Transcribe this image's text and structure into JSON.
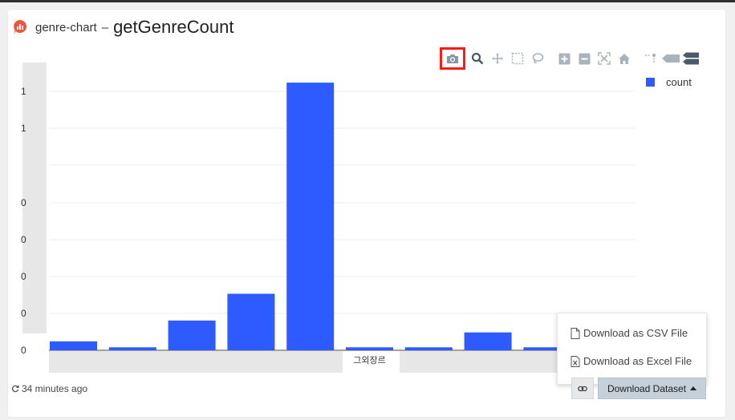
{
  "header": {
    "chart_name": "genre-chart",
    "separator": "–",
    "function_name": "getGenreCount"
  },
  "modebar": {
    "buttons": [
      "camera-icon",
      "zoom-icon",
      "pan-icon",
      "box-select-icon",
      "lasso-select-icon",
      "zoom-in-icon",
      "zoom-out-icon",
      "autoscale-icon",
      "reset-axes-icon",
      "spike-lines-icon",
      "hover-closest-icon",
      "hover-compare-icon"
    ],
    "highlighted": "camera-icon",
    "highlight_color": "#ff1a1a"
  },
  "chart_data": {
    "type": "bar",
    "series": [
      {
        "name": "count",
        "values": [
          0.06,
          0.02,
          0.2,
          0.38,
          1.8,
          0.02,
          0.02,
          0.12,
          0.02,
          0.02
        ]
      }
    ],
    "categories": [
      "",
      "",
      "",
      "",
      "",
      "그외장르",
      "",
      "",
      "",
      ""
    ],
    "y_tick_labels": [
      "0",
      "0",
      "0",
      "0",
      "0",
      "1",
      "1"
    ],
    "ylim": [
      0,
      2
    ],
    "bar_color": "#2d5bff",
    "legend_position": "top-right",
    "grid": true
  },
  "dropdown": {
    "csv_label": "Download as CSV File",
    "excel_label": "Download as Excel File"
  },
  "footer": {
    "updated": "34 minutes ago",
    "download_label": "Download Dataset"
  }
}
